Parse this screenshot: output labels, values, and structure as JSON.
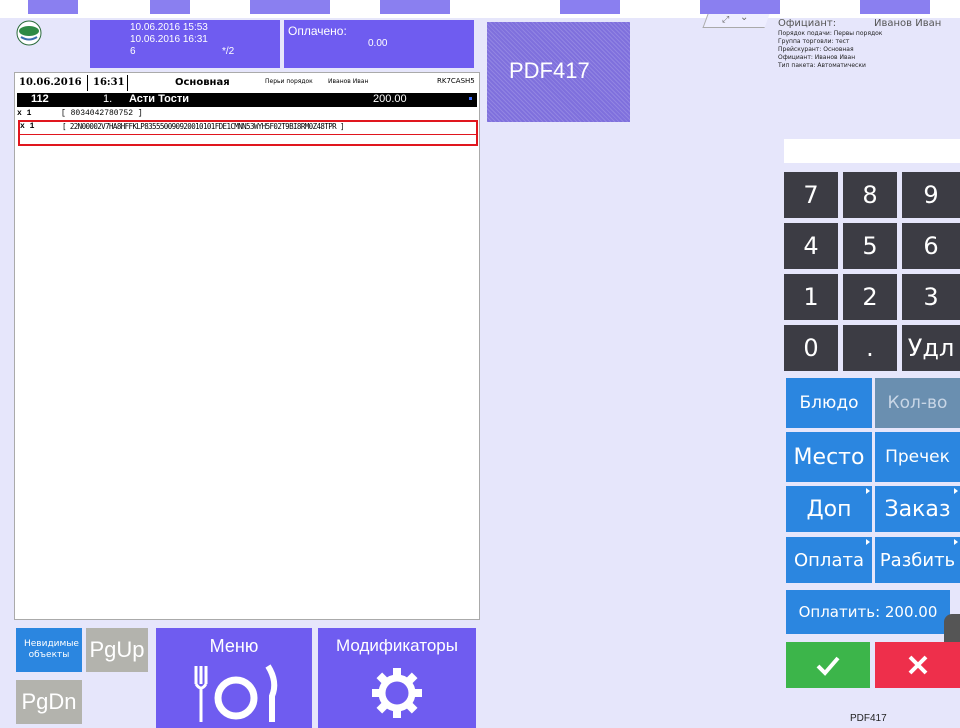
{
  "header": {
    "datetime1": "10.06.2016 15:53",
    "datetime2": "10.06.2016 16:31",
    "guests": "6",
    "table_code": "*/2",
    "paid_label": "Оплачено:",
    "paid_value": "0.00"
  },
  "pdf417_label": "PDF417",
  "receipt": {
    "date": "10.06.2016",
    "time": "16:31",
    "menu": "Основная",
    "serve_order": "Перьи порядок",
    "waiter": "Иванов Иван",
    "station": "RK7CASH5",
    "order_no": "112",
    "line_no": "1.",
    "dish": "Асти Тости",
    "dish_price": "200.00",
    "mod1_qty": "x 1",
    "mod1_code": "[ 8034042780752 ]",
    "mod2_qty": "x 1",
    "mod2_code": "[ 22N00002V7HA8HFFKLP835550090920010101FDE1CMNN53WYH5F02T9BI8RM0Z48TPR ]"
  },
  "info": {
    "waiter_label": "Официант:",
    "waiter_name": "Иванов Иван",
    "line1": "Порядок подачи: Первы порядок",
    "line2": "Группа торговли: тест",
    "line3": "Прейскурант: Основная",
    "line4": "Официант: Иванов Иван",
    "line5": "Тип пакета: Автоматически"
  },
  "keypad": {
    "k7": "7",
    "k8": "8",
    "k9": "9",
    "k4": "4",
    "k5": "5",
    "k6": "6",
    "k1": "1",
    "k2": "2",
    "k3": "3",
    "k0": "0",
    "dot": ".",
    "del": "Удл"
  },
  "actions": {
    "dish": "Блюдо",
    "qty": "Кол-во",
    "place": "Место",
    "precheck": "Пречек",
    "extra": "Доп",
    "order": "Заказ",
    "payment": "Оплата",
    "split": "Разбить",
    "pay_total": "Оплатить: 200.00"
  },
  "bottom": {
    "invisible": "Невидимые объекты",
    "pgup": "PgUp",
    "pgdn": "PgDn",
    "menu": "Меню",
    "modifiers": "Модификаторы"
  },
  "footer_label": "PDF417",
  "colors": {
    "purple": "#6f5cf0",
    "blue": "#2b86e0",
    "green": "#3cb54a",
    "red": "#ee2f4b",
    "numkey": "#3c3c44"
  }
}
